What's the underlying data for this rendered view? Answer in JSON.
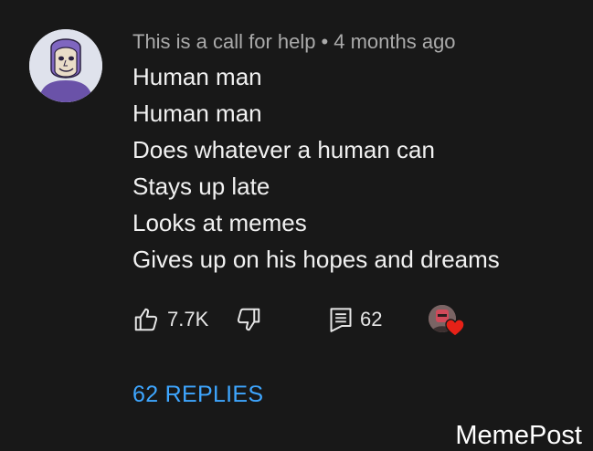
{
  "comment": {
    "author": "This is a call for help",
    "separator": "•",
    "time": "4 months ago",
    "lines": [
      "Human man",
      "Human man",
      "Does whatever a human can",
      "Stays up late",
      "Looks at memes",
      "Gives up on his hopes and dreams"
    ]
  },
  "actions": {
    "like_count": "7.7K",
    "reply_count": "62"
  },
  "replies_label": "62 REPLIES",
  "watermark": "MemePost",
  "icons": {
    "like": "thumbs-up-icon",
    "dislike": "thumbs-down-icon",
    "reply": "comment-icon",
    "heart": "heart-icon"
  },
  "colors": {
    "background": "#181818",
    "link": "#3ea6ff",
    "heart": "#e62117"
  }
}
